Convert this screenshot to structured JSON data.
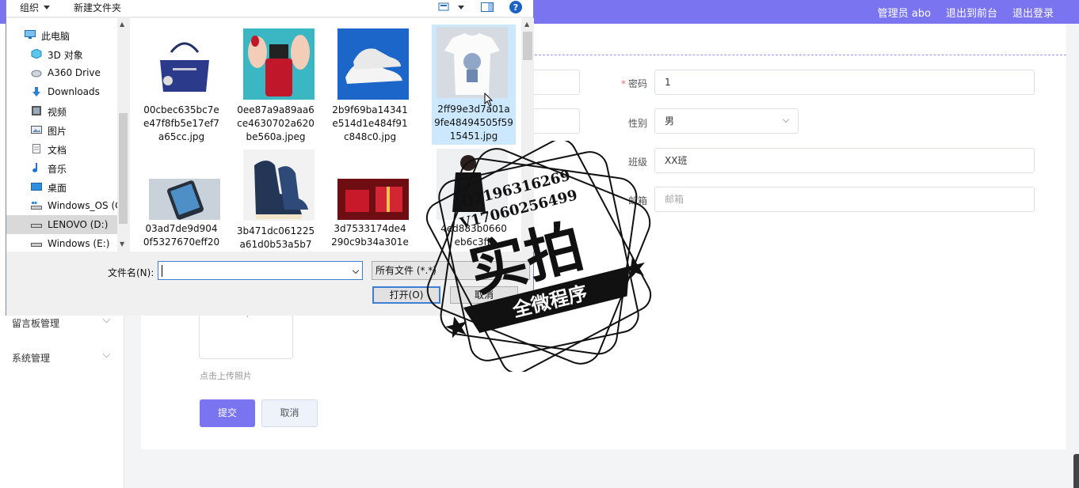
{
  "topbar": {
    "admin": "管理员 abo",
    "front": "退出到前台",
    "logout": "退出登录"
  },
  "sidebar": {
    "items": [
      {
        "label": "留言板管理"
      },
      {
        "label": "系统管理"
      }
    ]
  },
  "form": {
    "password": {
      "label": "密码",
      "required": "*",
      "value": "1"
    },
    "gender": {
      "label": "性别",
      "value": "男"
    },
    "class": {
      "label": "班级",
      "value": "XX班"
    },
    "email": {
      "label": "邮箱",
      "placeholder": "邮箱"
    },
    "upload_hint": "点击上传照片",
    "upload_plus": "+",
    "submit": "提交",
    "cancel": "取消"
  },
  "dialog": {
    "toolbar": {
      "organize": "组织",
      "new_folder": "新建文件夹",
      "help": "?"
    },
    "nav": [
      {
        "label": "此电脑",
        "icon": "computer-icon"
      },
      {
        "label": "3D 对象",
        "icon": "cube-icon"
      },
      {
        "label": "A360 Drive",
        "icon": "cloud-drive-icon"
      },
      {
        "label": "Downloads",
        "icon": "download-arrow-icon"
      },
      {
        "label": "视频",
        "icon": "video-icon"
      },
      {
        "label": "图片",
        "icon": "picture-icon"
      },
      {
        "label": "文档",
        "icon": "document-icon"
      },
      {
        "label": "音乐",
        "icon": "music-note-icon"
      },
      {
        "label": "桌面",
        "icon": "desktop-icon"
      },
      {
        "label": "Windows_OS (C",
        "icon": "os-drive-icon"
      },
      {
        "label": "LENOVO (D:)",
        "icon": "drive-icon"
      },
      {
        "label": "Windows (E:)",
        "icon": "drive-icon"
      }
    ],
    "files": [
      {
        "name_lines": [
          "00cbec635bc7e",
          "e47f8fb5e17ef7",
          "a65cc.jpg"
        ],
        "thumb": "handbag"
      },
      {
        "name_lines": [
          "0ee87a9a89aa6",
          "ce4630702a620",
          "be560a.jpeg"
        ],
        "thumb": "nails"
      },
      {
        "name_lines": [
          "2b9f69ba14341",
          "e514d1e484f91",
          "c848c0.jpg"
        ],
        "thumb": "sneakers"
      },
      {
        "name_lines": [
          "2ff99e3d7a01a",
          "9fe48494505f59",
          "15451.jpg"
        ],
        "thumb": "tshirt"
      },
      {
        "name_lines": [
          "03ad7de9d904",
          "0f5327670eff20"
        ],
        "thumb": "phone"
      },
      {
        "name_lines": [
          "3b471dc061225",
          "a61d0b53a5b7"
        ],
        "thumb": "hightops"
      },
      {
        "name_lines": [
          "3d7533174de4",
          "290c9b34a301e"
        ],
        "thumb": "giftbox"
      },
      {
        "name_lines": [
          "4ed883b0660",
          "eb6c3fb"
        ],
        "thumb": "model"
      }
    ],
    "filename_label": "文件名(N):",
    "filename_value": "",
    "filetype": "所有文件 (*.*)",
    "open": "打开(O)",
    "cancel": "取消"
  },
  "stamp": {
    "qq": "Q2196316269",
    "wx": "V17060256499",
    "main": "实拍",
    "banner": "全微程序"
  }
}
